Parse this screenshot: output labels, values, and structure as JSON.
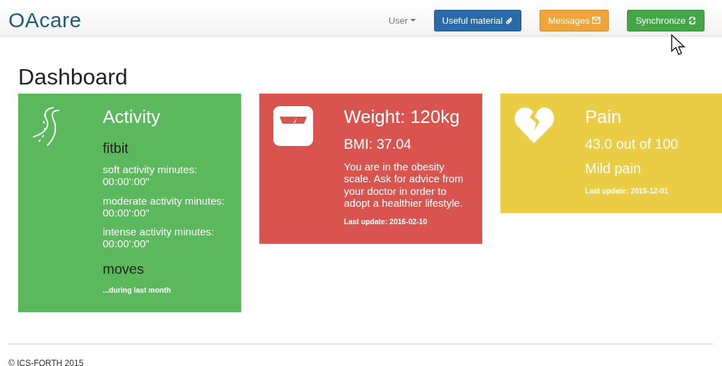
{
  "navbar": {
    "brand": "OAcare",
    "user_menu": "User",
    "buttons": [
      {
        "label": "Useful material",
        "kind": "material",
        "color": "#2a6aa8"
      },
      {
        "label": "Messages",
        "kind": "messages",
        "color": "#f0a53c"
      },
      {
        "label": "Synchronize",
        "kind": "sync",
        "color": "#45a648"
      }
    ]
  },
  "page_title": "Dashboard",
  "cards": [
    {
      "kind": "activity",
      "color": "#5cb85c",
      "lines": [
        {
          "kind": "title",
          "text": "Activity"
        },
        {
          "kind": "source",
          "text": "fitbit"
        },
        {
          "kind": "text",
          "text": "soft activity minutes: 00:00':00\""
        },
        {
          "kind": "text",
          "text": "moderate activity minutes: 00:00':00\""
        },
        {
          "kind": "text",
          "text": "intense activity minutes: 00:00':00\""
        },
        {
          "kind": "source",
          "text": "moves"
        },
        {
          "kind": "note",
          "text": "...during last month"
        }
      ]
    },
    {
      "kind": "weight",
      "color": "#d9534f",
      "lines": [
        {
          "kind": "title",
          "text": "Weight: 120kg"
        },
        {
          "kind": "metric",
          "text": "BMI: 37.04"
        },
        {
          "kind": "text",
          "text": "You are in the obesity scale. Ask for advice from your doctor in order to adopt a healthier lifestyle."
        },
        {
          "kind": "note",
          "text": "Last update: 2016-02-10"
        }
      ]
    },
    {
      "kind": "pain",
      "color": "#ebcd45",
      "lines": [
        {
          "kind": "title",
          "text": "Pain"
        },
        {
          "kind": "metric",
          "text": "43.0 out of 100"
        },
        {
          "kind": "metric",
          "text": "Mild pain"
        },
        {
          "kind": "note",
          "text": "Last update: 2015-12-01"
        }
      ]
    }
  ],
  "footer": "© ICS-FORTH 2015"
}
